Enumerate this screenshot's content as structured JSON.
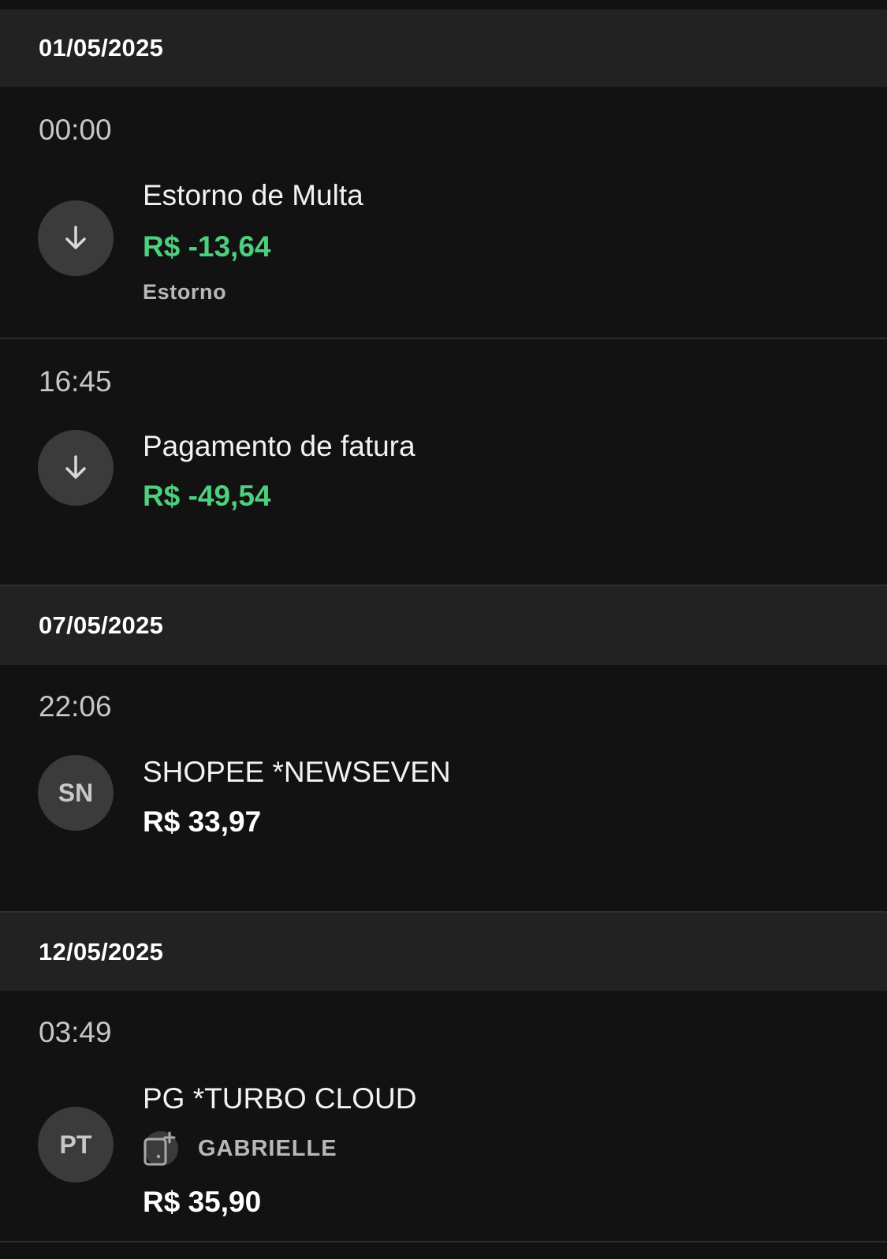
{
  "groups": [
    {
      "date": "01/05/2025",
      "transactions": [
        {
          "time": "00:00",
          "avatar_icon": "arrow-down-icon",
          "title": "Estorno de Multa",
          "amount": "R$ -13,64",
          "amount_type": "credit",
          "tag": "Estorno"
        },
        {
          "time": "16:45",
          "avatar_icon": "arrow-down-icon",
          "title": "Pagamento de fatura",
          "amount": "R$ -49,54",
          "amount_type": "credit"
        }
      ]
    },
    {
      "date": "07/05/2025",
      "transactions": [
        {
          "time": "22:06",
          "avatar_initials": "SN",
          "title": "SHOPEE *NEWSEVEN",
          "amount": "R$ 33,97",
          "amount_type": "debit"
        }
      ]
    },
    {
      "date": "12/05/2025",
      "transactions": [
        {
          "time": "03:49",
          "avatar_initials": "PT",
          "title": "PG *TURBO CLOUD",
          "card_icon": "virtual-card-icon",
          "card_holder": "GABRIELLE",
          "amount": "R$ 35,90",
          "amount_type": "debit"
        }
      ]
    }
  ],
  "colors": {
    "background": "#121212",
    "header_background": "#222222",
    "credit_amount": "#4dcf7e",
    "debit_amount": "#ffffff",
    "avatar_background": "#3b3b3b"
  }
}
